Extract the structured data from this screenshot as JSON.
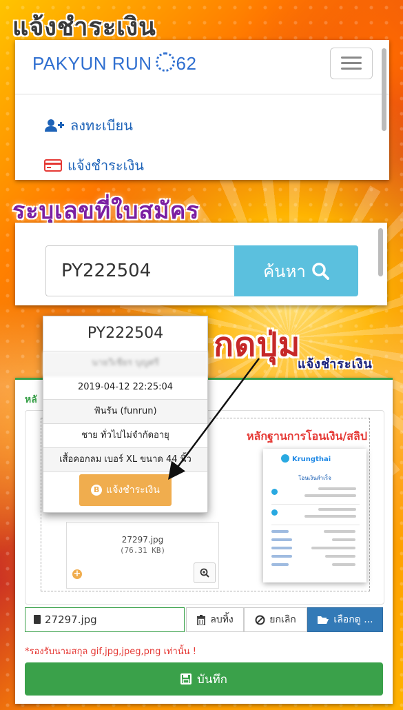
{
  "headings": {
    "step1": "แจ้งชำระเงิน",
    "step2": "ระบุเลขที่ใบสมัคร",
    "step3": "กดปุ่ม",
    "step3_sub": "แจ้งชำระเงิน"
  },
  "navbar": {
    "brand_left": "PAKYUN RUN",
    "brand_right": "62",
    "menu": [
      {
        "label": "ลงทะเบียน",
        "icon": "user-plus-icon"
      },
      {
        "label": "แจ้งชำระเงิน",
        "icon": "credit-card-icon"
      }
    ]
  },
  "search": {
    "value": "PY222504",
    "button_label": "ค้นหา"
  },
  "popup": {
    "application_no": "PY222504",
    "name": "นายวิเชียร บุญศรี",
    "datetime": "2019-04-12 22:25:04",
    "event": "ฟันรัน (funrun)",
    "category": "ชาย ทั่วไปไม่จำกัดอายุ",
    "shirt": "เสื้อคอกลม เบอร์ XL ขนาด 44 นิ้ว",
    "pay_button": "แจ้งชำระเงิน"
  },
  "upload": {
    "section_title": "หลั",
    "slip_label": "หลักฐานการโอนเงิน/สลิป",
    "thumb_filename": "27297.jpg",
    "thumb_size": "(76.31 KB)",
    "file_value": "27297.jpg",
    "remove_label": "ลบทิ้ง",
    "cancel_label": "ยกเลิก",
    "browse_label": "เลือกดู ...",
    "note": "*รองรับนามสกุล gif,jpg,jpeg,png เท่านั้น !",
    "save_label": "บันทึก"
  },
  "slip": {
    "bank": "Krungthai",
    "title": "โอนเงินสำเร็จ"
  },
  "colors": {
    "brand": "#2f6fd0",
    "search_button": "#5bc0de",
    "pay_button": "#f0ad4e",
    "save_button": "#3aa14a",
    "browse_button": "#337ab7",
    "annotation_red": "#c62828"
  }
}
